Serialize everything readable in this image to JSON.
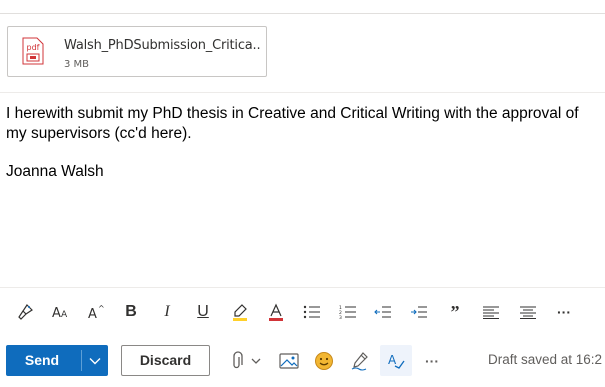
{
  "attachment": {
    "file_name": "Walsh_PhDSubmission_Critica...",
    "file_size": "3 MB",
    "icon_label": "pdf"
  },
  "body": {
    "paragraph": "I herewith submit my PhD thesis in Creative and Critical Writing with the approval of my supervisors (cc'd here).",
    "signature": "Joanna Walsh"
  },
  "format_toolbar": {
    "items": [
      "format-painter",
      "font-size-decrease",
      "font-size-increase",
      "bold",
      "italic",
      "underline",
      "highlight",
      "font-color",
      "bullets",
      "numbering",
      "decrease-indent",
      "increase-indent",
      "quote",
      "align-left",
      "align-center",
      "more-options"
    ],
    "bold_glyph": "B",
    "italic_glyph": "I",
    "underline_glyph": "U",
    "quote_glyph": "”",
    "more_glyph": "···"
  },
  "actions": {
    "send_label": "Send",
    "discard_label": "Discard",
    "more_glyph": "···",
    "draft_status": "Draft saved at 16:2"
  },
  "colors": {
    "accent": "#0f6cbd",
    "pdf_red": "#d13438",
    "highlight_yellow": "#ffd02a",
    "font_color_red": "#d13438",
    "emoji_yellow": "#f2b632",
    "editor_blue": "#0f6cbd"
  }
}
